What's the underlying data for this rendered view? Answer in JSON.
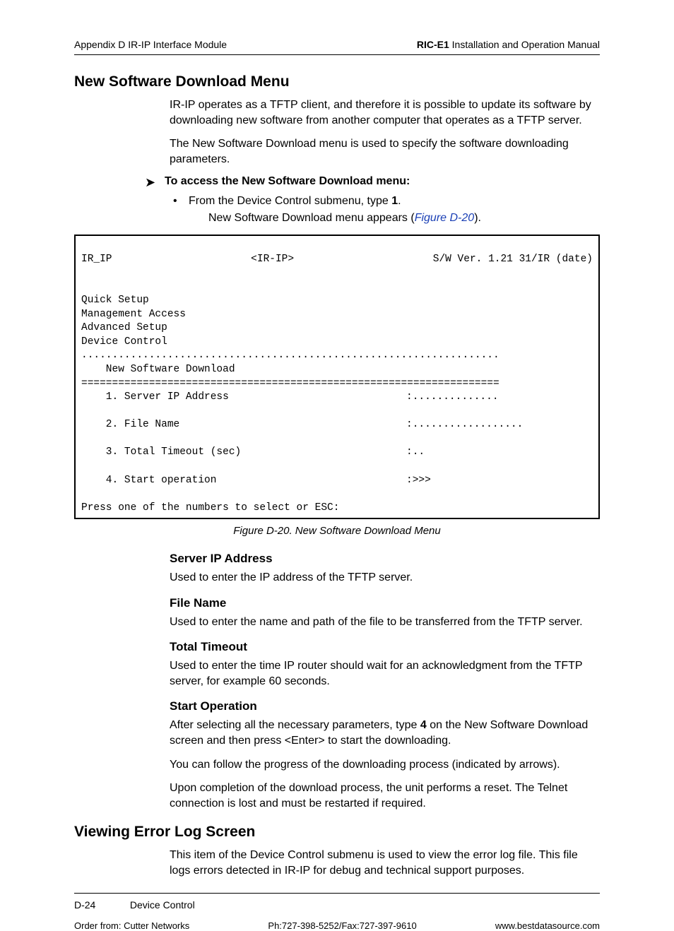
{
  "header": {
    "left": "Appendix D  IR-IP Interface Module",
    "right_bold": "RIC-E1",
    "right_rest": " Installation and Operation Manual"
  },
  "s1": {
    "h": "New Software Download Menu",
    "p1": "IR-IP operates as a TFTP client, and therefore it is possible to update its software by downloading new software from another computer that operates as a TFTP server.",
    "p2": "The New Software Download menu is used to specify the software downloading parameters.",
    "arrow": "To access the New Software Download menu:",
    "bullet_pre": "From the Device Control submenu, type ",
    "bullet_bold": "1",
    "bullet_post": ".",
    "result_pre": "New Software Download menu appears (",
    "result_link": "Figure D-20",
    "result_post": ")."
  },
  "term": {
    "title_l": "IR_IP",
    "title_c": "<IR-IP>",
    "title_r": "S/W Ver. 1.21 31/IR (date)",
    "nav1": "Quick Setup",
    "nav2": "Management Access",
    "nav3": "Advanced Setup",
    "nav4": "Device Control",
    "dots": "....................................................................",
    "section": "    New Software Download",
    "eq": "====================================================================",
    "m1l": "    1. Server IP Address",
    "m1r": ":..............",
    "m2l": "    2. File Name",
    "m2r": ":..................",
    "m3l": "    3. Total Timeout (sec)",
    "m3r": ":..",
    "m4l": "    4. Start operation",
    "m4r": ":>>>",
    "prompt": "Press one of the numbers to select or ESC:"
  },
  "figcap": "Figure D-20.  New Software Download Menu",
  "sub": {
    "sip_h": "Server IP Address",
    "sip_p": "Used to enter the IP address of the TFTP server.",
    "fn_h": "File Name",
    "fn_p": "Used to enter the name and path of the file to be transferred from the TFTP server.",
    "tt_h": "Total Timeout",
    "tt_p": "Used to enter the time IP router should wait for an acknowledgment from the TFTP server, for example 60 seconds.",
    "so_h": "Start Operation",
    "so_p1a": "After selecting all the necessary parameters, type ",
    "so_p1b": "4",
    "so_p1c": " on the New Software Download screen and then press <Enter> to start the downloading.",
    "so_p2": "You can follow the progress of the downloading process (indicated by arrows).",
    "so_p3": "Upon completion of the download process, the unit performs a reset. The Telnet connection is lost and must be restarted if required."
  },
  "s2": {
    "h": "Viewing Error Log Screen",
    "p": "This item of the Device Control submenu is used to view the error log file. This file logs errors detected in IR-IP for debug and technical support purposes."
  },
  "footer": {
    "page": "D-24",
    "section": "Device Control",
    "order": "Order from: Cutter Networks",
    "phone": "Ph:727-398-5252/Fax:727-397-9610",
    "url": "www.bestdatasource.com"
  }
}
